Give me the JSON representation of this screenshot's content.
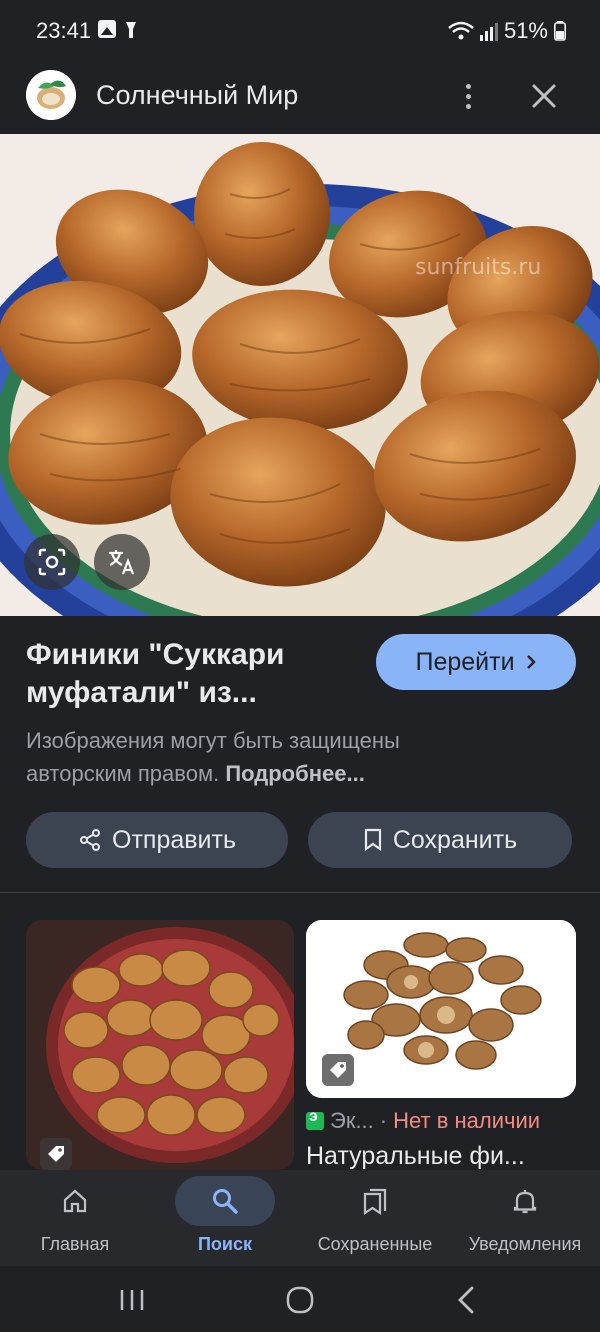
{
  "status_bar": {
    "time": "23:41",
    "battery": "51%",
    "icons": [
      "image-notification-icon",
      "flashlight-icon",
      "wifi-icon",
      "signal-icon",
      "battery-icon"
    ]
  },
  "header": {
    "site_name": "Солнечный Мир",
    "icons": [
      "site-logo",
      "more-vert-icon",
      "close-icon"
    ]
  },
  "image": {
    "watermark": "sunfruits.ru",
    "overlay_buttons": [
      "lens-icon",
      "translate-icon"
    ]
  },
  "result": {
    "title": "Финики \"Суккари муфатали\" из...",
    "visit_label": "Перейти",
    "copyright_text": "Изображения могут быть защищены авторским правом.",
    "learn_more": "Подробнее..."
  },
  "actions": {
    "share_label": "Отправить",
    "save_label": "Сохранить"
  },
  "related": [
    {
      "badge": "tag-icon"
    },
    {
      "badge": "tag-icon",
      "source": "Эк...",
      "separator": "·",
      "stock": "Нет в наличии",
      "title": "Натуральные фи..."
    }
  ],
  "bottom_nav": [
    {
      "label": "Главная",
      "icon": "home-icon",
      "active": false
    },
    {
      "label": "Поиск",
      "icon": "search-icon",
      "active": true
    },
    {
      "label": "Сохраненные",
      "icon": "collections-icon",
      "active": false
    },
    {
      "label": "Уведомления",
      "icon": "bell-icon",
      "active": false
    }
  ],
  "colors": {
    "background": "#202124",
    "accent": "#8ab4f8",
    "button_bg": "#3c4452",
    "stock_red": "#f28b82"
  }
}
